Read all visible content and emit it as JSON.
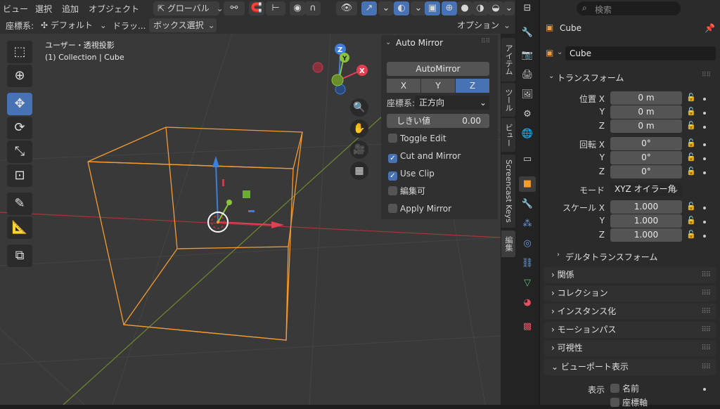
{
  "header": {
    "menu": [
      "ビュー",
      "選択",
      "追加",
      "オブジェクト"
    ],
    "transform_orientation": "グローバル"
  },
  "toolheader": {
    "coord_label": "座標系:",
    "coord_value": "デフォルト",
    "drag_label": "ドラッ...",
    "drag_value": "ボックス選択",
    "options": "オプション"
  },
  "viewport": {
    "view_name": "ユーザー・透視投影",
    "collection": "(1) Collection | Cube",
    "gizmo_axes": [
      "X",
      "Y",
      "Z"
    ]
  },
  "npanel": {
    "title": "Auto Mirror",
    "button": "AutoMirror",
    "axes": [
      "X",
      "Y",
      "Z"
    ],
    "selected_axis": "Z",
    "coord_label": "座標系:",
    "coord_value": "正方向",
    "threshold_label": "しきい値",
    "threshold_value": "0.00",
    "checkboxes": [
      {
        "label": "Toggle Edit",
        "checked": false
      },
      {
        "label": "Cut and Mirror",
        "checked": true
      },
      {
        "label": "Use Clip",
        "checked": true
      },
      {
        "label": "編集可",
        "checked": false
      },
      {
        "label": "Apply Mirror",
        "checked": false
      }
    ]
  },
  "vtabs": [
    "アイテム",
    "ツール",
    "ビュー",
    "Screencast Keys",
    "編集"
  ],
  "properties": {
    "search_placeholder": "検索",
    "object_name": "Cube",
    "data_name": "Cube",
    "transform_title": "トランスフォーム",
    "location_label": "位置 X",
    "rotation_label": "回転 X",
    "scale_label": "スケール X",
    "y_label": "Y",
    "z_label": "Z",
    "location": [
      "0 m",
      "0 m",
      "0 m"
    ],
    "rotation": [
      "0°",
      "0°",
      "0°"
    ],
    "mode_label": "モード",
    "mode_value": "XYZ オイラー角",
    "scale": [
      "1.000",
      "1.000",
      "1.000"
    ],
    "delta": "デルタトランスフォーム",
    "sections": [
      "関係",
      "コレクション",
      "インスタンス化",
      "モーションパス",
      "可視性",
      "ビューポート表示"
    ],
    "display_label": "表示",
    "display_name": "名前",
    "display_axes": "座標軸"
  },
  "colors": {
    "accent": "#4772b3",
    "select_orange": "#f59b2d",
    "axis_x": "#e23f52",
    "axis_y": "#8ac43b",
    "axis_z": "#3f7fdb"
  }
}
